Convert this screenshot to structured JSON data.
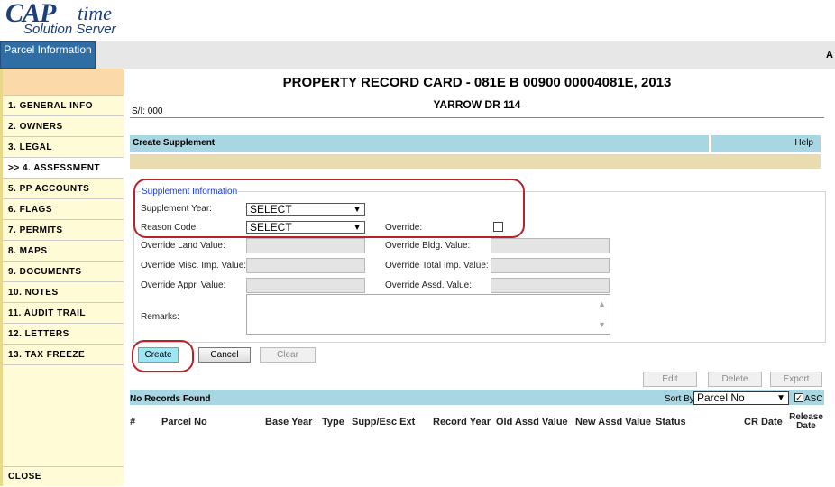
{
  "logo": {
    "cap": "CAP",
    "time": "time",
    "solution": "Solution Server"
  },
  "header": {
    "parcel_tab": "Parcel Information",
    "right_text": "A"
  },
  "sidebar": {
    "items": [
      {
        "label": "1. GENERAL INFO"
      },
      {
        "label": "2. OWNERS"
      },
      {
        "label": "3. LEGAL"
      },
      {
        "label": ">> 4. ASSESSMENT"
      },
      {
        "label": "5. PP ACCOUNTS"
      },
      {
        "label": "6. FLAGS"
      },
      {
        "label": "7. PERMITS"
      },
      {
        "label": "8. MAPS"
      },
      {
        "label": "9. DOCUMENTS"
      },
      {
        "label": "10. NOTES"
      },
      {
        "label": "11. AUDIT TRAIL"
      },
      {
        "label": "12. LETTERS"
      },
      {
        "label": "13. TAX FREEZE"
      }
    ],
    "close": "CLOSE"
  },
  "main": {
    "title": "PROPERTY RECORD CARD - 081E B 00900 00004081E, 2013",
    "subtitle": "YARROW DR 114",
    "sfl": "S/I: 000",
    "section_title": "Create Supplement",
    "help": "Help"
  },
  "form": {
    "legend": "Supplement Information",
    "supplement_year_label": "Supplement Year:",
    "supplement_year_value": "SELECT",
    "reason_code_label": "Reason Code:",
    "reason_code_value": "SELECT",
    "override_label": "Override:",
    "override_land_label": "Override Land Value:",
    "override_bldg_label": "Override Bldg. Value:",
    "override_misc_label": "Override Misc. Imp. Value:",
    "override_total_label": "Override Total Imp. Value:",
    "override_appr_label": "Override Appr. Value:",
    "override_assd_label": "Override Assd. Value:",
    "remarks_label": "Remarks:"
  },
  "buttons": {
    "create": "Create",
    "cancel": "Cancel",
    "clear": "Clear",
    "edit": "Edit",
    "delete": "Delete",
    "export": "Export"
  },
  "records": {
    "status": "No Records Found",
    "sort_by_label": "Sort By:",
    "sort_by_value": "Parcel No",
    "asc_label": "ASC",
    "columns": [
      "#",
      "Parcel No",
      "Base Year",
      "Type",
      "Supp/Esc Ext",
      "Record Year",
      "Old Assd Value",
      "New Assd Value",
      "Status",
      "CR Date",
      "Release Date"
    ]
  }
}
